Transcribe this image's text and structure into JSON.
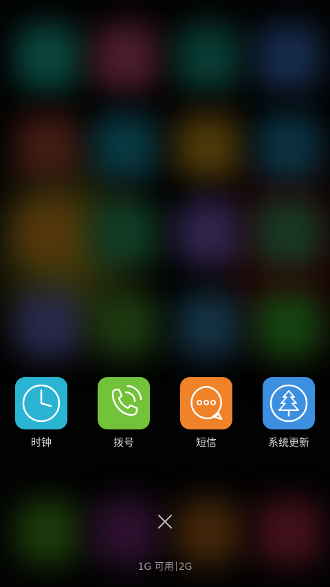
{
  "recent_apps": [
    {
      "label": "时钟",
      "icon": "clock-icon",
      "color": "#2BB3D3"
    },
    {
      "label": "拨号",
      "icon": "phone-icon",
      "color": "#72C23A"
    },
    {
      "label": "短信",
      "icon": "message-icon",
      "color": "#F0822A"
    },
    {
      "label": "系统更新",
      "icon": "update-tree-icon",
      "color": "#3D8FE0"
    }
  ],
  "close_icon": "close-icon",
  "memory": {
    "available": "1G 可用",
    "total": "2G"
  }
}
